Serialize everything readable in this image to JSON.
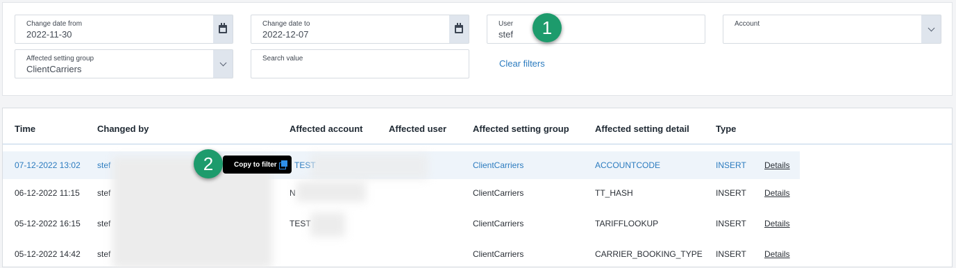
{
  "filters": {
    "change_date_from": {
      "label": "Change date from",
      "value": "2022-11-30",
      "icon": "calendar-icon"
    },
    "change_date_to": {
      "label": "Change date to",
      "value": "2022-12-07",
      "icon": "calendar-icon"
    },
    "user": {
      "label": "User",
      "value": "stef"
    },
    "account": {
      "label": "Account",
      "value": "",
      "icon": "chevron-down-icon"
    },
    "affected_setting_group": {
      "label": "Affected setting group",
      "value": "ClientCarriers",
      "icon": "chevron-down-icon"
    },
    "search_value": {
      "label": "Search value",
      "value": ""
    },
    "clear_label": "Clear filters"
  },
  "markers": {
    "one": "1",
    "two": "2",
    "color": "#1d9b6c"
  },
  "table": {
    "columns": [
      "Time",
      "Changed by",
      "Affected account",
      "Affected user",
      "Affected setting group",
      "Affected setting detail",
      "Type"
    ],
    "rows": [
      {
        "time": "07-12-2022 13:02",
        "changed_by": "stef",
        "account": "TEST",
        "user": "",
        "group": "ClientCarriers",
        "detail": "ACCOUNTCODE",
        "type": "INSERT",
        "details": "Details"
      },
      {
        "time": "06-12-2022 11:15",
        "changed_by": "stef",
        "account": "N",
        "user": "",
        "group": "ClientCarriers",
        "detail": "TT_HASH",
        "type": "INSERT",
        "details": "Details"
      },
      {
        "time": "05-12-2022 16:15",
        "changed_by": "stef",
        "account": "TEST",
        "user": "",
        "group": "ClientCarriers",
        "detail": "TARIFFLOOKUP",
        "type": "INSERT",
        "details": "Details"
      },
      {
        "time": "05-12-2022 14:42",
        "changed_by": "stef",
        "account": "",
        "user": "",
        "group": "ClientCarriers",
        "detail": "CARRIER_BOOKING_TYPE",
        "type": "INSERT",
        "details": "Details"
      }
    ]
  },
  "tooltip": {
    "label": "Copy to filter",
    "icon": "copy-icon"
  },
  "colors": {
    "accent": "#2b7bbf",
    "selected_row": "#eef4fa",
    "marker": "#1d9b6c"
  }
}
